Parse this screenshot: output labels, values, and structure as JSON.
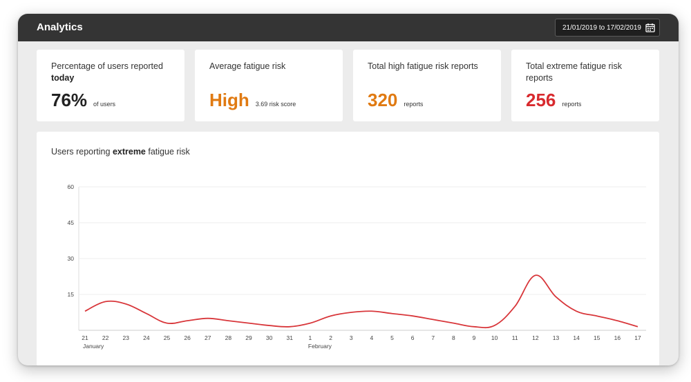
{
  "header": {
    "title": "Analytics",
    "date_range": "21/01/2019 to 17/02/2019",
    "date_icon": "calendar-icon"
  },
  "cards": [
    {
      "label_pre": "Percentage of users reported ",
      "label_bold": "today",
      "label_post": "",
      "value": "76%",
      "unit": "of users",
      "color": "#222222"
    },
    {
      "label_pre": "Average fatigue risk",
      "label_bold": "",
      "label_post": "",
      "value": "High",
      "unit": "3.69 risk score",
      "color": "#e07a12"
    },
    {
      "label_pre": "Total high fatigue risk reports",
      "label_bold": "",
      "label_post": "",
      "value": "320",
      "unit": "reports",
      "color": "#e07a12"
    },
    {
      "label_pre": "Total extreme fatigue risk reports",
      "label_bold": "",
      "label_post": "",
      "value": "256",
      "unit": "reports",
      "color": "#d82a2e"
    }
  ],
  "chart_title": {
    "pre": "Users reporting ",
    "bold": "extreme",
    "post": " fatigue risk"
  },
  "chart_data": {
    "type": "line",
    "title": "Users reporting extreme fatigue risk",
    "x": [
      "21",
      "22",
      "23",
      "24",
      "25",
      "26",
      "27",
      "28",
      "29",
      "30",
      "31",
      "1",
      "2",
      "3",
      "4",
      "5",
      "6",
      "7",
      "8",
      "9",
      "10",
      "11",
      "12",
      "13",
      "14",
      "15",
      "16",
      "17"
    ],
    "month_labels": [
      {
        "index": 0,
        "label": "January"
      },
      {
        "index": 11,
        "label": "February"
      }
    ],
    "yticks": [
      15,
      30,
      45,
      60
    ],
    "ylim": [
      0,
      60
    ],
    "grid": true,
    "line_color": "#d8363a",
    "series": [
      {
        "values": [
          8,
          12,
          11,
          7,
          3,
          4,
          5,
          4,
          3,
          2,
          1.5,
          3,
          6,
          7.5,
          8,
          7,
          6,
          4.5,
          3,
          1.5,
          2,
          10,
          23,
          14,
          8,
          6,
          4,
          1.5
        ]
      }
    ]
  }
}
